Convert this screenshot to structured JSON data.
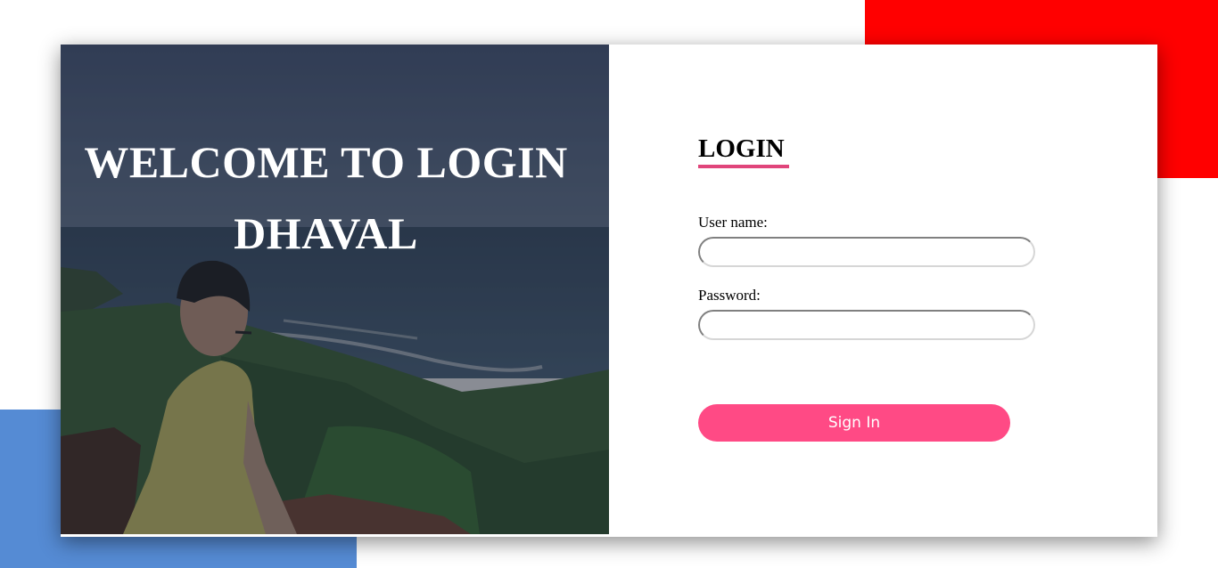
{
  "page": {
    "welcome_title": "WELCOME TO LOGIN DHAVAL"
  },
  "hero_image": {
    "alt": "Man in yellow shirt looking at a coastal view"
  },
  "login_form": {
    "heading": "LOGIN",
    "username_label": "User name:",
    "username_value": "",
    "password_label": "Password:",
    "password_value": "",
    "submit_label": "Sign In"
  },
  "colors": {
    "accent": "#ff4a85",
    "underline": "#e0457b",
    "deco_red": "#ff0000",
    "deco_blue": "#558bd4"
  }
}
